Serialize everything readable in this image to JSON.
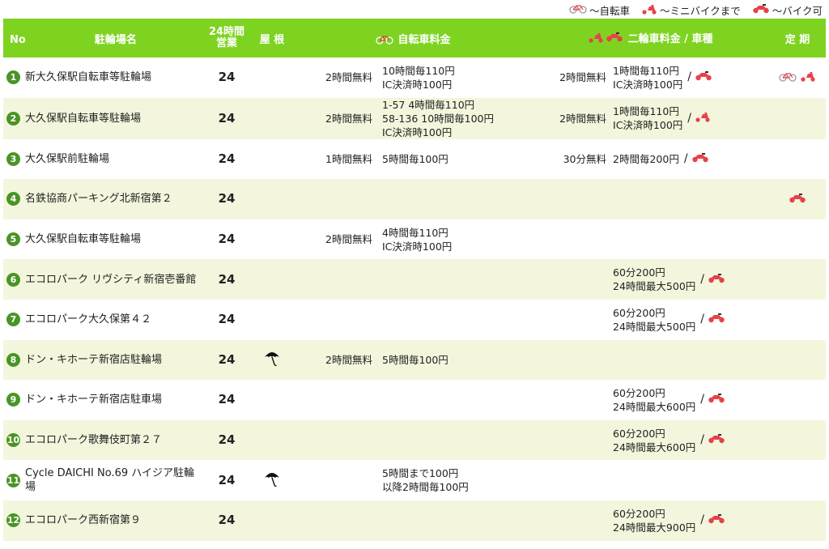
{
  "legend": [
    {
      "icon": "bicycle-icon",
      "label": "～自転車"
    },
    {
      "icon": "scooter-icon",
      "label": "～ミニバイクまで"
    },
    {
      "icon": "motorcycle-icon",
      "label": "～バイク可"
    }
  ],
  "header": {
    "no": "No",
    "name": "駐輪場名",
    "hours_line1": "24時間",
    "hours_line2": "営業",
    "roof": "屋 根",
    "bike_fee": "自転車料金",
    "moto_fee": "二輪車料金 / 車種",
    "regular": "定 期"
  },
  "colors": {
    "header_bg": "#7ed321",
    "row_alt_bg": "#f3f6dc",
    "number_badge": "#4a9426",
    "icon_red": "#e8414b"
  },
  "rows": [
    {
      "no": "1",
      "name": "新大久保駅自転車等駐輪場",
      "hours": "24",
      "roof": "",
      "bike_free": "2時間無料",
      "bike_fee": [
        "10時間毎110円",
        "IC決済時100円"
      ],
      "moto_free": "2時間無料",
      "moto_fee": [
        "1時間毎110円",
        "IC決済時100円"
      ],
      "moto_slash": "/",
      "moto_icon": "motorcycle-icon",
      "regular": [
        "bicycle-icon",
        "scooter-icon"
      ]
    },
    {
      "no": "2",
      "name": "大久保駅自転車等駐輪場",
      "hours": "24",
      "roof": "",
      "bike_free": "2時間無料",
      "bike_fee": [
        "1-57 4時間毎110円",
        "58-136 10時間毎100円",
        "IC決済時100円"
      ],
      "moto_free": "2時間無料",
      "moto_fee": [
        "1時間毎110円",
        "IC決済時100円"
      ],
      "moto_slash": "/",
      "moto_icon": "scooter-icon",
      "regular": []
    },
    {
      "no": "3",
      "name": "大久保駅前駐輪場",
      "hours": "24",
      "roof": "",
      "bike_free": "1時間無料",
      "bike_fee": [
        "5時間毎100円"
      ],
      "moto_free": "30分無料",
      "moto_fee": [
        "2時間毎200円"
      ],
      "moto_slash": "/",
      "moto_icon": "motorcycle-icon",
      "regular": []
    },
    {
      "no": "4",
      "name": "名鉄協商パーキング北新宿第２",
      "hours": "24",
      "roof": "",
      "bike_free": "",
      "bike_fee": [],
      "moto_free": "",
      "moto_fee": [],
      "moto_slash": "",
      "moto_icon": "",
      "regular": [
        "motorcycle-icon"
      ]
    },
    {
      "no": "5",
      "name": "大久保駅自転車等駐輪場",
      "hours": "24",
      "roof": "",
      "bike_free": "2時間無料",
      "bike_fee": [
        "4時間毎110円",
        "IC決済時100円"
      ],
      "moto_free": "",
      "moto_fee": [],
      "moto_slash": "",
      "moto_icon": "",
      "regular": []
    },
    {
      "no": "6",
      "name": "エコロパーク リヴシティ新宿壱番館",
      "hours": "24",
      "roof": "",
      "bike_free": "",
      "bike_fee": [],
      "moto_free": "",
      "moto_fee": [
        "60分200円",
        "24時間最大500円"
      ],
      "moto_slash": "/",
      "moto_icon": "motorcycle-icon",
      "regular": []
    },
    {
      "no": "7",
      "name": "エコロパーク大久保第４２",
      "hours": "24",
      "roof": "",
      "bike_free": "",
      "bike_fee": [],
      "moto_free": "",
      "moto_fee": [
        "60分200円",
        "24時間最大500円"
      ],
      "moto_slash": "/",
      "moto_icon": "motorcycle-icon",
      "regular": []
    },
    {
      "no": "8",
      "name": "ドン・キホーテ新宿店駐輪場",
      "hours": "24",
      "roof": "umbrella-icon",
      "bike_free": "2時間無料",
      "bike_fee": [
        "5時間毎100円"
      ],
      "moto_free": "",
      "moto_fee": [],
      "moto_slash": "",
      "moto_icon": "",
      "regular": []
    },
    {
      "no": "9",
      "name": "ドン・キホーテ新宿店駐車場",
      "hours": "24",
      "roof": "",
      "bike_free": "",
      "bike_fee": [],
      "moto_free": "",
      "moto_fee": [
        "60分200円",
        "24時間最大600円"
      ],
      "moto_slash": "/",
      "moto_icon": "motorcycle-icon",
      "regular": []
    },
    {
      "no": "10",
      "name": "エコロパーク歌舞伎町第２７",
      "hours": "24",
      "roof": "",
      "bike_free": "",
      "bike_fee": [],
      "moto_free": "",
      "moto_fee": [
        "60分200円",
        "24時間最大600円"
      ],
      "moto_slash": "/",
      "moto_icon": "motorcycle-icon",
      "regular": []
    },
    {
      "no": "11",
      "name": "Cycle DAICHI No.69 ハイジア駐輪場",
      "hours": "24",
      "roof": "umbrella-icon",
      "bike_free": "",
      "bike_fee": [
        "5時間まで100円",
        "以降2時間毎100円"
      ],
      "moto_free": "",
      "moto_fee": [],
      "moto_slash": "",
      "moto_icon": "",
      "regular": []
    },
    {
      "no": "12",
      "name": "エコロパーク西新宿第９",
      "hours": "24",
      "roof": "",
      "bike_free": "",
      "bike_fee": [],
      "moto_free": "",
      "moto_fee": [
        "60分200円",
        "24時間最大900円"
      ],
      "moto_slash": "/",
      "moto_icon": "motorcycle-icon",
      "regular": []
    }
  ]
}
